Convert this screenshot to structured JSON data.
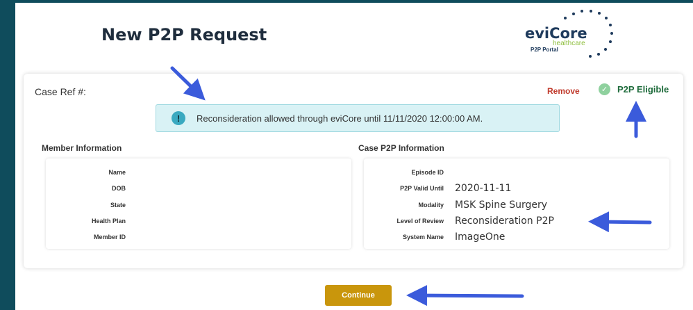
{
  "page": {
    "title": "New P2P Request"
  },
  "logo": {
    "brand": "eviCore",
    "sub": "healthcare",
    "portal": "P2P Portal"
  },
  "case": {
    "ref_label": "Case Ref #:",
    "remove_label": "Remove",
    "eligible_label": "P2P Eligible"
  },
  "alert": {
    "text": "Reconsideration allowed through eviCore until 11/11/2020 12:00:00 AM."
  },
  "member": {
    "section_title": "Member Information",
    "fields": [
      {
        "label": "Name",
        "value": ""
      },
      {
        "label": "DOB",
        "value": ""
      },
      {
        "label": "State",
        "value": ""
      },
      {
        "label": "Health Plan",
        "value": ""
      },
      {
        "label": "Member ID",
        "value": ""
      }
    ]
  },
  "case_p2p": {
    "section_title": "Case P2P Information",
    "fields": [
      {
        "label": "Episode ID",
        "value": ""
      },
      {
        "label": "P2P Valid Until",
        "value": "2020-11-11"
      },
      {
        "label": "Modality",
        "value": "MSK Spine Surgery"
      },
      {
        "label": "Level of Review",
        "value": "Reconsideration P2P"
      },
      {
        "label": "System Name",
        "value": "ImageOne"
      }
    ]
  },
  "actions": {
    "continue_label": "Continue"
  },
  "colors": {
    "sidebar": "#0f4c5c",
    "accent_button": "#c9960c",
    "arrow": "#3b5bdb",
    "remove": "#c0392b",
    "eligible": "#1e6b3b"
  }
}
